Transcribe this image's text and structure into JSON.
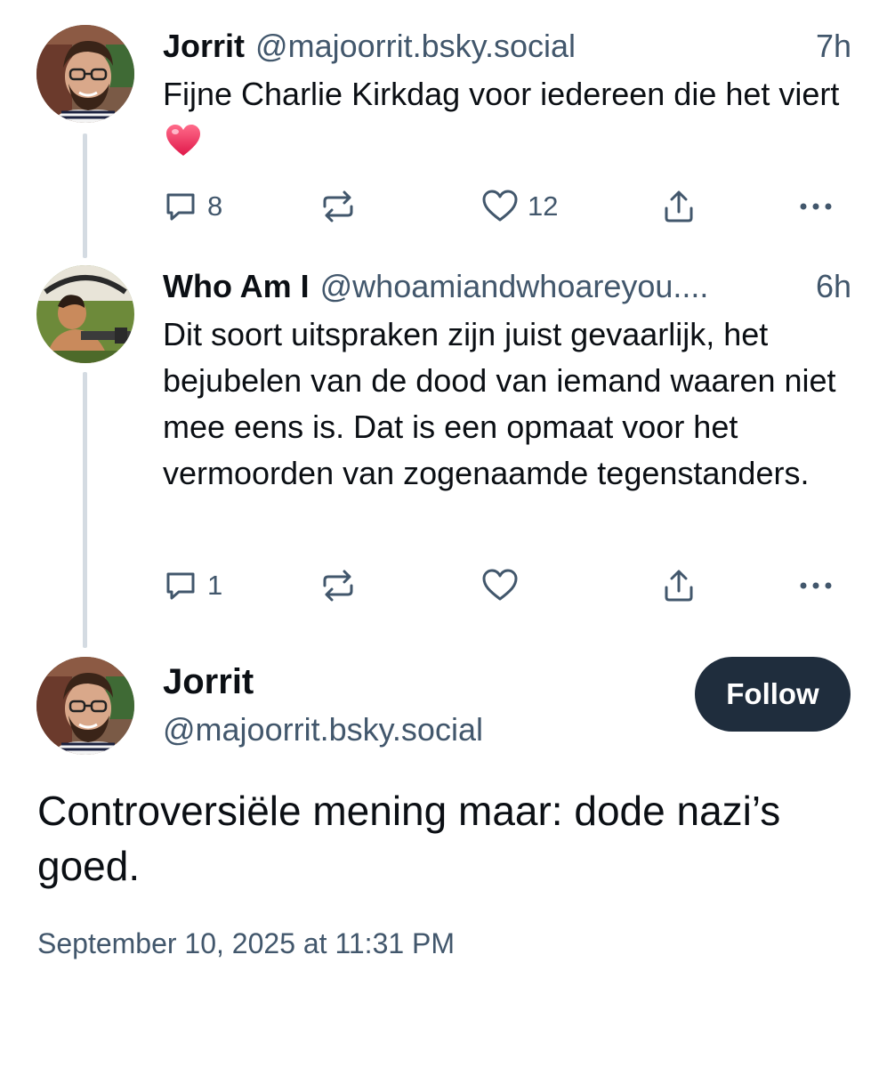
{
  "thread": [
    {
      "author_name": "Jorrit",
      "author_handle": "@majoorrit.bsky.social",
      "time": "7h",
      "text": "Fijne Charlie Kirkdag voor iedereen die het viert",
      "emoji": "red-heart-emoji",
      "replies": "8",
      "reposts": "",
      "likes": "12"
    },
    {
      "author_name": "Who Am I",
      "author_handle": "@whoamiandwhoareyou....",
      "time": "6h",
      "text": "Dit soort uitspraken zijn juist gevaarlijk, het bejubelen van de dood van iemand waaren niet mee eens is. Dat is een opmaat voor het vermoorden van zogenaamde tegenstanders.",
      "replies": "1",
      "reposts": "",
      "likes": ""
    }
  ],
  "main_post": {
    "author_name": "Jorrit",
    "author_handle": "@majoorrit.bsky.social",
    "follow_label": "Follow",
    "text": "Controversiële mening maar: dode nazi’s goed.",
    "timestamp": "September 10, 2025 at 11:31 PM"
  },
  "icons": [
    "reply-icon",
    "repost-icon",
    "like-icon",
    "share-icon",
    "more-icon"
  ],
  "colors": {
    "text": "#0b0f14",
    "muted": "#42576c",
    "thread_line": "#d4dbe2",
    "follow_button": "#1f2d3d",
    "emoji_heart": "#f0365f"
  }
}
